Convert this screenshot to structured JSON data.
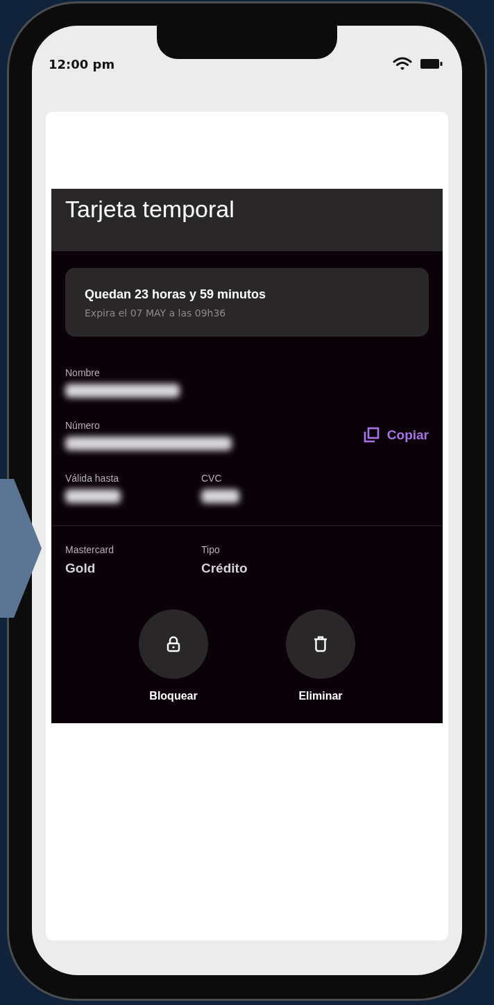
{
  "status_bar": {
    "time": "12:00 pm"
  },
  "header": {
    "title": "Tarjeta temporal"
  },
  "countdown": {
    "title": "Quedan 23 horas y 59 minutos",
    "subtitle": "Expira el 07 MAY a las 09h36"
  },
  "card_rows": [
    {
      "fields": [
        {
          "label": "Nombre",
          "kind": "masked"
        }
      ]
    },
    {
      "fields": [
        {
          "label": "Número",
          "kind": "masked"
        }
      ],
      "action": "Copiar"
    },
    {
      "fields": [
        {
          "label": "Válida hasta",
          "kind": "masked"
        },
        {
          "label": "CVC",
          "kind": "masked"
        }
      ]
    }
  ],
  "details": [
    {
      "label": "Mastercard",
      "value": "Gold",
      "kind": "text"
    },
    {
      "label": "Tipo",
      "value": "Crédito",
      "kind": "text"
    }
  ],
  "actions": [
    {
      "label": "Bloquear",
      "kind": "lock"
    },
    {
      "label": "Eliminar",
      "kind": "trash"
    }
  ]
}
